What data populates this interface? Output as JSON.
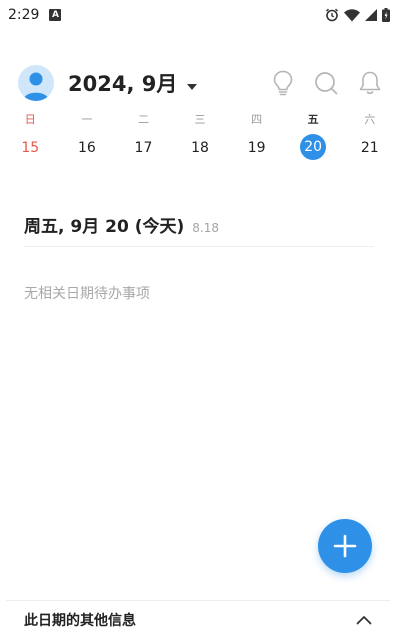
{
  "status_bar": {
    "time": "2:29",
    "app_badge": "A"
  },
  "header": {
    "month_title": "2024, 9月"
  },
  "week": {
    "weekdays": [
      {
        "label": "日",
        "day": "15"
      },
      {
        "label": "一",
        "day": "16"
      },
      {
        "label": "二",
        "day": "17"
      },
      {
        "label": "三",
        "day": "18"
      },
      {
        "label": "四",
        "day": "19"
      },
      {
        "label": "五",
        "day": "20"
      },
      {
        "label": "六",
        "day": "21"
      }
    ],
    "selected_index": 5
  },
  "selected_date": {
    "title": "周五, 9月 20 (今天)",
    "lunar": "8.18"
  },
  "todo": {
    "empty_message": "无相关日期待办事项"
  },
  "bottom_sheet": {
    "title": "此日期的其他信息"
  },
  "colors": {
    "accent": "#2e90e6",
    "sunday": "#e55a4a",
    "muted": "#a8a8a8"
  },
  "icons": {
    "status_bar": [
      "alarm-icon",
      "wifi-icon",
      "cell-signal-icon",
      "battery-icon"
    ],
    "header": [
      "lightbulb-icon",
      "search-icon",
      "bell-icon"
    ],
    "fab": "plus-icon",
    "bottom_sheet": "chevron-up-icon"
  }
}
